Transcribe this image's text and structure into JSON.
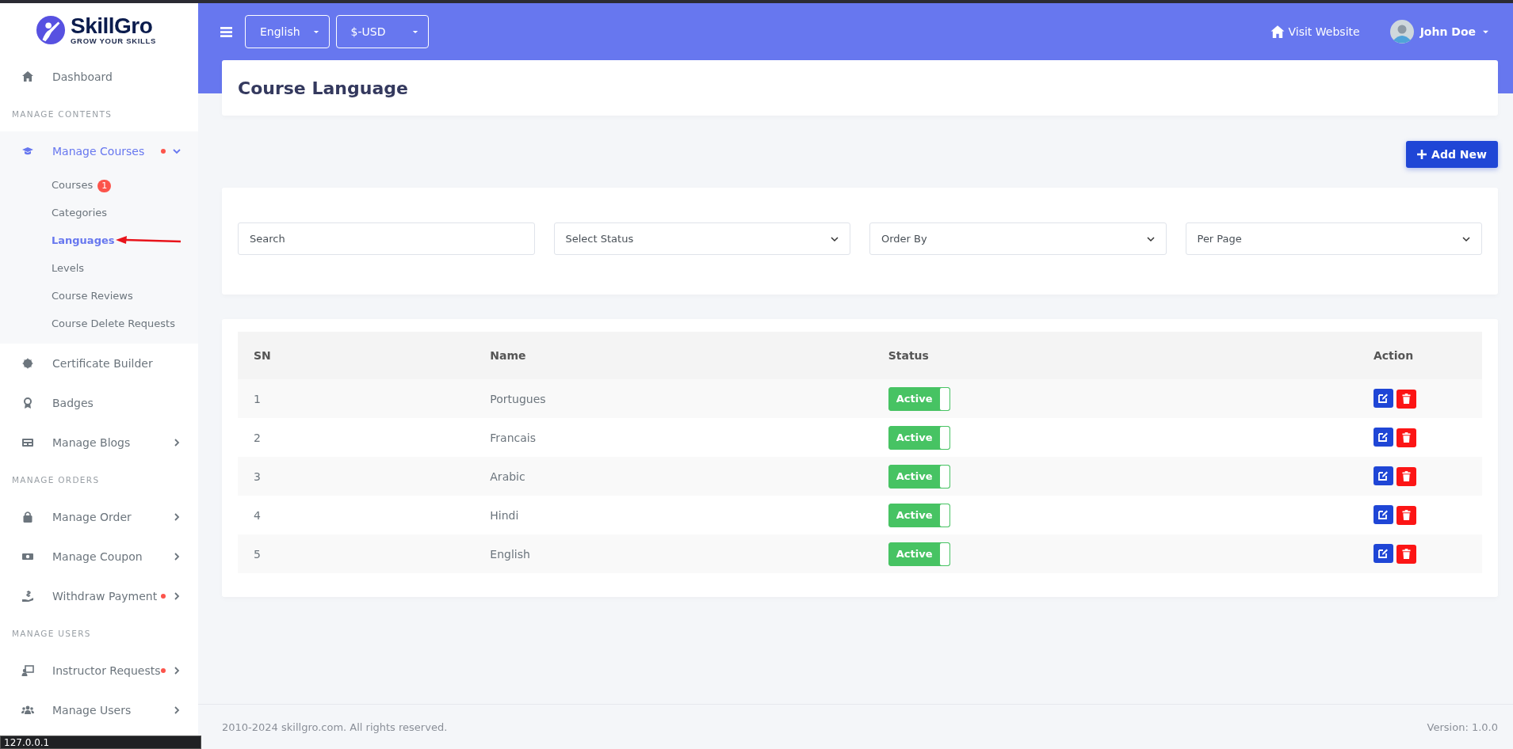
{
  "sidebar": {
    "logo": {
      "name": "SkillGro",
      "tagline": "GROW YOUR SKILLS"
    },
    "sections": [
      {
        "items": [
          {
            "label": "Dashboard",
            "kind": "link",
            "selected": false,
            "alert": false
          }
        ]
      },
      {
        "heading": "MANAGE CONTENTS",
        "items": [
          {
            "label": "Manage Courses",
            "kind": "menu",
            "expanded": true,
            "selected": true,
            "alert": true,
            "children": [
              {
                "label": "Courses",
                "selected": false,
                "badge": "1"
              },
              {
                "label": "Categories",
                "selected": false
              },
              {
                "label": "Languages",
                "selected": true
              },
              {
                "label": "Levels",
                "selected": false
              },
              {
                "label": "Course Reviews",
                "selected": false
              },
              {
                "label": "Course Delete Requests",
                "selected": false
              }
            ]
          },
          {
            "label": "Certificate Builder",
            "kind": "link",
            "selected": false,
            "alert": false
          },
          {
            "label": "Badges",
            "kind": "link",
            "selected": false,
            "alert": false
          },
          {
            "label": "Manage Blogs",
            "kind": "menu",
            "expanded": false,
            "selected": false,
            "alert": false
          }
        ]
      },
      {
        "heading": "MANAGE ORDERS",
        "items": [
          {
            "label": "Manage Order",
            "kind": "menu",
            "expanded": false,
            "selected": false,
            "alert": false
          },
          {
            "label": "Manage Coupon",
            "kind": "menu",
            "expanded": false,
            "selected": false,
            "alert": false
          },
          {
            "label": "Withdraw Payment",
            "kind": "menu",
            "expanded": false,
            "selected": false,
            "alert": true
          }
        ]
      },
      {
        "heading": "MANAGE USERS",
        "items": [
          {
            "label": "Instructor Requests",
            "kind": "menu",
            "expanded": false,
            "selected": false,
            "alert": true
          },
          {
            "label": "Manage Users",
            "kind": "menu",
            "expanded": false,
            "selected": false,
            "alert": false
          }
        ]
      }
    ]
  },
  "topbar": {
    "language": "English",
    "currency": "$-USD",
    "visit_link": "Visit Website",
    "user": "John Doe"
  },
  "page": {
    "title": "Course Language",
    "add_button": "Add New",
    "filters": {
      "search": {
        "placeholder": "Search"
      },
      "selects": [
        "Select Status",
        "Order By",
        "Per Page"
      ]
    },
    "table": {
      "columns": [
        "SN",
        "Name",
        "Status",
        "Action"
      ],
      "rows": [
        {
          "sn": "1",
          "name": "Portugues",
          "status": {
            "label": "Active",
            "on": true
          }
        },
        {
          "sn": "2",
          "name": "Francais",
          "status": {
            "label": "Active",
            "on": true
          }
        },
        {
          "sn": "3",
          "name": "Arabic",
          "status": {
            "label": "Active",
            "on": true
          }
        },
        {
          "sn": "4",
          "name": "Hindi",
          "status": {
            "label": "Active",
            "on": true
          }
        },
        {
          "sn": "5",
          "name": "English",
          "status": {
            "label": "Active",
            "on": true
          }
        }
      ]
    }
  },
  "footer": {
    "copyright": "2010-2024 skillgro.com. All rights reserved.",
    "version": "Version: 1.0.0"
  },
  "status_tooltip": "127.0.0.1"
}
